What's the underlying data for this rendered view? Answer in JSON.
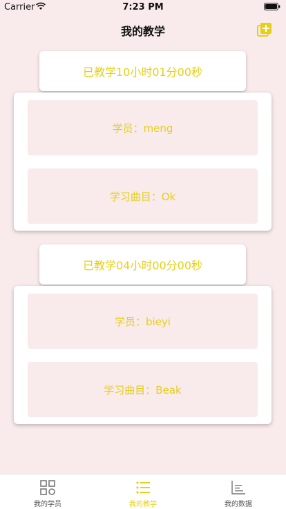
{
  "status_bar": {
    "carrier": "Carrier",
    "time": "7:23 PM"
  },
  "nav": {
    "title": "我的教学",
    "action_icon": "add-icon"
  },
  "colors": {
    "accent": "#e6cf17",
    "background": "#f9ebeb",
    "card": "#ffffff"
  },
  "sessions": [
    {
      "duration": "已教学10小时01分00秒",
      "student": "学员：meng",
      "piece": "学习曲目：Ok"
    },
    {
      "duration": "已教学04小时00分00秒",
      "student": "学员：bieyi",
      "piece": "学习曲目：Beak"
    }
  ],
  "tabs": [
    {
      "label": "我的学员",
      "icon": "grid-icon",
      "active": false
    },
    {
      "label": "我的教学",
      "icon": "list-icon",
      "active": true
    },
    {
      "label": "我的数据",
      "icon": "chart-icon",
      "active": false
    }
  ]
}
